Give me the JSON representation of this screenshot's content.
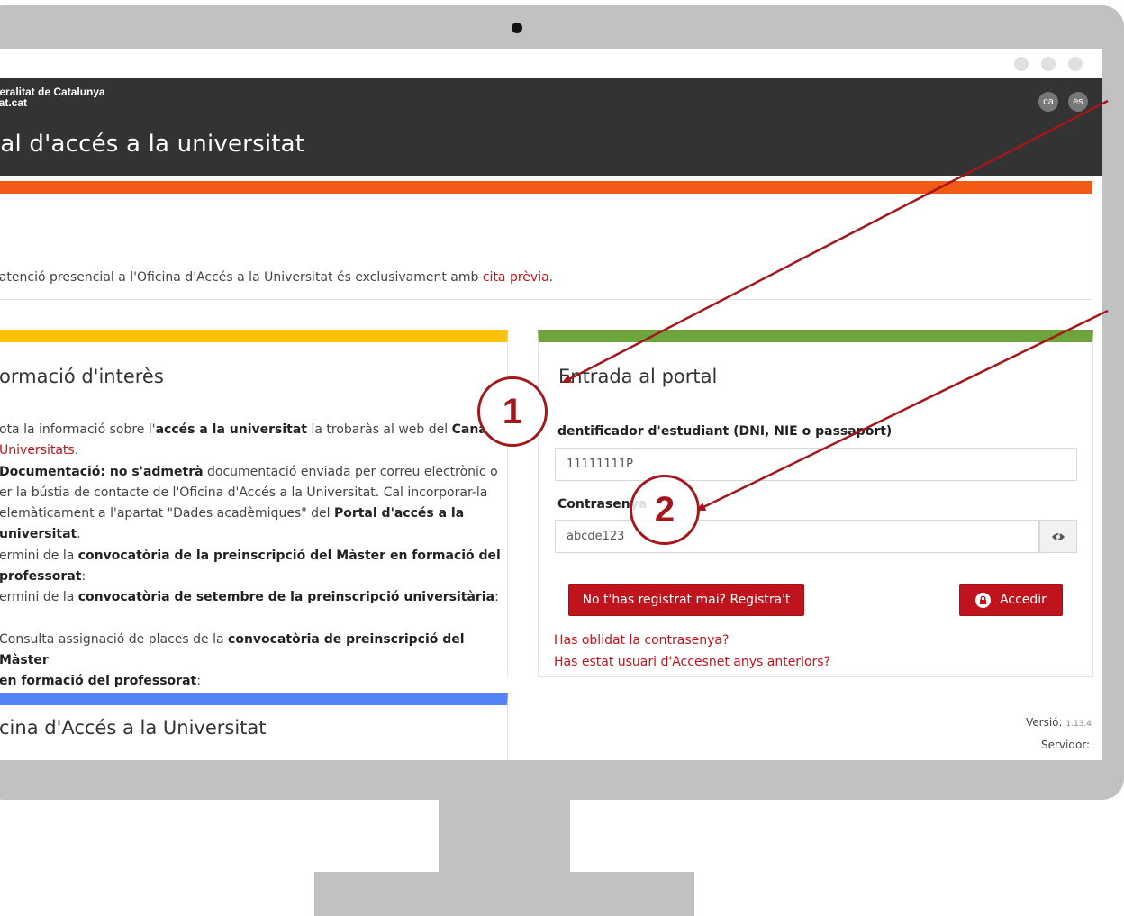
{
  "header": {
    "org_line1": "neralitat de Catalunya",
    "org_line2": "cat.cat",
    "portal_title": "tal d'accés a la universitat",
    "lang_ca": "ca",
    "lang_es": "es"
  },
  "notice": {
    "text_before": "'atenció presencial a l'Oficina d'Accés a la Universitat és exclusivament amb ",
    "link": "cita prèvia",
    "text_after": "."
  },
  "info": {
    "title": "ormació d'interès",
    "item1_a": "ota la informació sobre l'",
    "item1_b": "accés a la universitat",
    "item1_c": " la trobaràs al web del ",
    "item1_link1": "Cana",
    "item1_link2": "Universitats",
    "item1_end": ".",
    "item2_a": "Documentació: no s'admetrà",
    "item2_b": " documentació enviada per correu electrònic o",
    "item2_line2": "er la bústia de contacte de l'Oficina d'Accés a la Universitat. Cal incorporar-la",
    "item2_line3": "elemàticament a l'apartat \"Dades acadèmiques\" del ",
    "item2_link1": "Portal d'accés a la",
    "item2_link2": "universitat",
    "item2_end": ".",
    "item3_a": "ermini de la ",
    "item3_b": "convocatòria de la preinscripció del Màster en formació del",
    "item3_c": "professorat",
    "item3_end": ":",
    "item4_a": "ermini de la ",
    "item4_b": "convocatòria de setembre de la preinscripció universitària",
    "item4_end": ":",
    "item5_a": "Consulta assignació de places de la ",
    "item5_b": "convocatòria de preinscripció del Màster",
    "item5_c": "en formació del professorat",
    "item5_end": ":"
  },
  "login": {
    "title": "Entrada al portal",
    "id_label": "dentificador d'estudiant (DNI, NIE o passaport)",
    "id_value": "11111111P",
    "pw_label": "Contrasenya",
    "pw_value": "abcde123",
    "register_button": "No t'has registrat mai? Registra't",
    "login_button": "Accedir",
    "forgot_link": "Has oblidat la contrasenya?",
    "previous_user_link": "Has estat usuari d'Accesnet anys anteriors?"
  },
  "office": {
    "title": "cina d'Accés a la Universitat"
  },
  "footer": {
    "version_label": "Versió:",
    "version_value": "1.13.4",
    "server_label": "Servidor:"
  },
  "callouts": {
    "one": "1",
    "two": "2"
  },
  "colors": {
    "header_bg": "#333333",
    "notice_bar": "#f05a12",
    "info_bar": "#fec10c",
    "login_bar": "#6ea43c",
    "office_bar": "#5383f5",
    "accent_red": "#c0141c",
    "callout_red": "#a3171c"
  }
}
